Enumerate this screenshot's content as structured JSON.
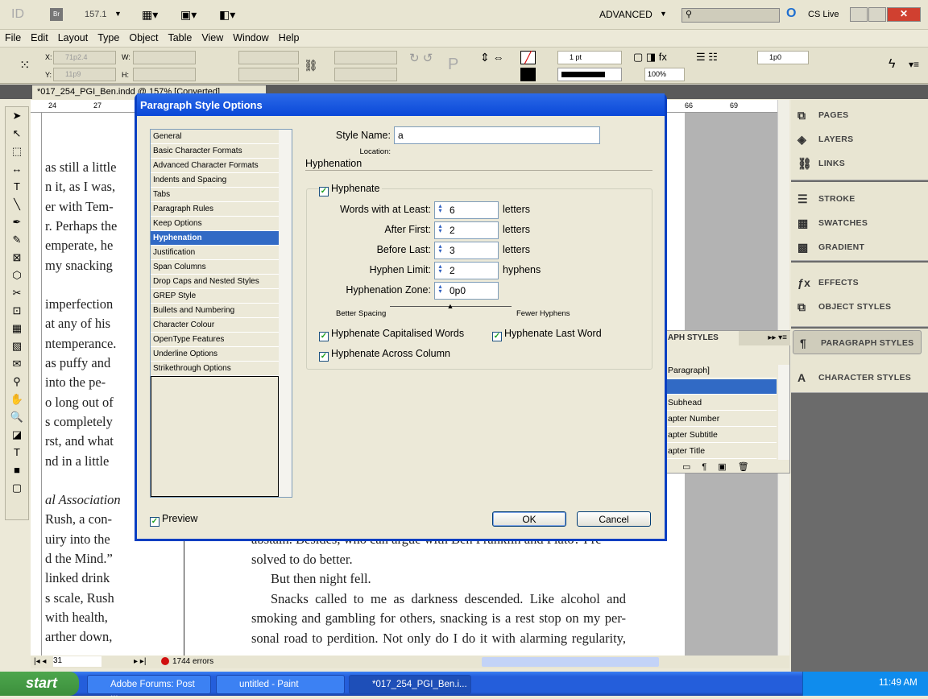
{
  "app": {
    "logo": "ID",
    "bridge": "Br",
    "zoom": "157.1",
    "workspace": "ADVANCED",
    "cslive": "CS Live"
  },
  "menu": [
    "File",
    "Edit",
    "Layout",
    "Type",
    "Object",
    "Table",
    "View",
    "Window",
    "Help"
  ],
  "control": {
    "x_label": "X:",
    "x_value": "71p2.4",
    "y_label": "Y:",
    "y_value": "11p9",
    "w_label": "W:",
    "h_label": "H:",
    "stroke_weight": "1 pt",
    "opacity": "100%",
    "offset": "1p0"
  },
  "document": {
    "tab": "*017_254_PGI_Ben.indd @ 157% [Converted]",
    "ruler_ticks": [
      "24",
      "27",
      "66",
      "69"
    ],
    "left_lines": [
      "as still a little",
      "n it, as I was,",
      "er with Tem-",
      "r. Perhaps the",
      "emperate, he",
      "my snacking",
      "",
      "imperfection",
      "at any of his",
      "ntemperance.",
      "as puffy and",
      "into the pe-",
      "o long out of",
      "s completely",
      "rst, and what",
      "nd in a little",
      "",
      "al Association",
      "Rush, a con-",
      "uiry into the",
      "d the Mind.”",
      "linked drink",
      "s scale, Rush",
      "with health,",
      "arther down,"
    ],
    "bottom_lines": [
      "abstain. Besides, who can argue with Ben Franklin and Plato? I re-",
      "solved to do better.",
      "But then night fell.",
      "Snacks called to me as darkness descended. Like alcohol and",
      "smoking and gambling for others, snacking is a rest stop on my per-",
      "sonal road to perdition. Not only do I do it with alarming regularity,"
    ]
  },
  "status": {
    "page": "31",
    "errors": "1744 errors"
  },
  "panels": {
    "items": [
      {
        "icon": "pages-icon",
        "label": "PAGES"
      },
      {
        "icon": "layers-icon",
        "label": "LAYERS"
      },
      {
        "icon": "links-icon",
        "label": "LINKS"
      },
      {
        "icon": "stroke-icon",
        "label": "STROKE"
      },
      {
        "icon": "swatches-icon",
        "label": "SWATCHES"
      },
      {
        "icon": "gradient-icon",
        "label": "GRADIENT"
      },
      {
        "icon": "effects-icon",
        "label": "EFFECTS"
      },
      {
        "icon": "object-styles-icon",
        "label": "OBJECT STYLES"
      },
      {
        "icon": "paragraph-styles-icon",
        "label": "PARAGRAPH STYLES"
      },
      {
        "icon": "character-styles-icon",
        "label": "CHARACTER STYLES"
      }
    ]
  },
  "para_panel": {
    "title": "APH STYLES",
    "rows": [
      "Paragraph]",
      "",
      "Subhead",
      "apter Number",
      "apter Subtitle",
      "apter Title"
    ]
  },
  "dialog": {
    "title": "Paragraph Style Options",
    "categories": [
      "General",
      "Basic Character Formats",
      "Advanced Character Formats",
      "Indents and Spacing",
      "Tabs",
      "Paragraph Rules",
      "Keep Options",
      "Hyphenation",
      "Justification",
      "Span Columns",
      "Drop Caps and Nested Styles",
      "GREP Style",
      "Bullets and Numbering",
      "Character Colour",
      "OpenType Features",
      "Underline Options",
      "Strikethrough Options"
    ],
    "selected": "Hyphenation",
    "style_name_label": "Style Name:",
    "style_name": "a",
    "location_label": "Location:",
    "section": "Hyphenation",
    "hyphenate": "Hyphenate",
    "fields": [
      {
        "label": "Words with at Least:",
        "value": "6",
        "unit": "letters"
      },
      {
        "label": "After First:",
        "value": "2",
        "unit": "letters"
      },
      {
        "label": "Before Last:",
        "value": "3",
        "unit": "letters"
      },
      {
        "label": "Hyphen Limit:",
        "value": "2",
        "unit": "hyphens"
      },
      {
        "label": "Hyphenation Zone:",
        "value": "0p0",
        "unit": ""
      }
    ],
    "slider_left": "Better Spacing",
    "slider_right": "Fewer Hyphens",
    "slider_value": 0.5,
    "cap_words": "Hyphenate Capitalised Words",
    "last_word": "Hyphenate Last Word",
    "across_column": "Hyphenate Across Column",
    "preview": "Preview",
    "ok": "OK",
    "cancel": "Cancel"
  },
  "taskbar": {
    "start": "start",
    "tasks": [
      "Adobe Forums: Post ...",
      "untitled - Paint",
      "*017_254_PGI_Ben.i..."
    ],
    "clock": "11:49 AM"
  }
}
